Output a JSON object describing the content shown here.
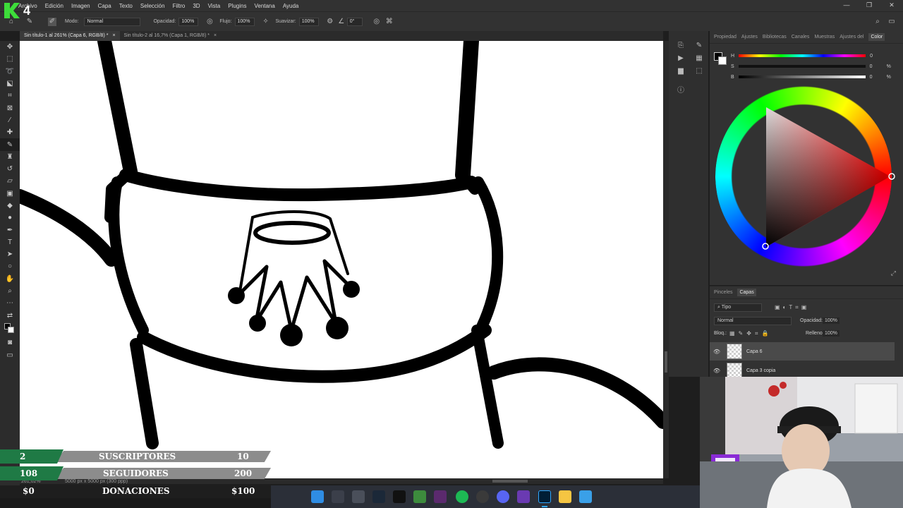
{
  "app": {
    "logo_text": "4"
  },
  "menu": [
    "Archivo",
    "Edición",
    "Imagen",
    "Capa",
    "Texto",
    "Selección",
    "Filtro",
    "3D",
    "Vista",
    "Plugins",
    "Ventana",
    "Ayuda"
  ],
  "window_controls": {
    "minimize": "—",
    "restore": "❐",
    "close": "✕"
  },
  "options": {
    "mode_label": "Modo:",
    "mode_value": "Normal",
    "opacity_label": "Opacidad:",
    "opacity_value": "100%",
    "flow_label": "Flujo:",
    "flow_value": "100%",
    "smoothing_label": "Suavizar:",
    "smoothing_value": "100%",
    "angle_value": "0°"
  },
  "tabs": [
    {
      "label": "Sin título-1 al 261% (Capa 6, RGB/8) *",
      "close": "×"
    },
    {
      "label": "Sin título-2 al 16,7% (Capa 1, RGB/8) *",
      "close": "×"
    }
  ],
  "color_panel": {
    "tabs": [
      "Propiedad",
      "Ajustes",
      "Bibliotecas",
      "Canales",
      "Muestras",
      "Ajustes del",
      "Color"
    ],
    "sliders": [
      {
        "label": "H",
        "value": "0",
        "unit": ""
      },
      {
        "label": "S",
        "value": "0",
        "unit": "%"
      },
      {
        "label": "B",
        "value": "0",
        "unit": "%"
      }
    ]
  },
  "layers_panel": {
    "tabs": [
      "Pinceles",
      "Capas"
    ],
    "filter_label": "Tipo",
    "blend_mode": "Normal",
    "opacity_label": "Opacidad:",
    "opacity_value": "100%",
    "lock_label": "Bloq.:",
    "fill_label": "Relleno:",
    "fill_value": "100%",
    "layers": [
      {
        "name": "Capa 6",
        "selected": true
      },
      {
        "name": "Capa 3 copia",
        "selected": false
      }
    ]
  },
  "status_bar": {
    "zoom": "261,02%",
    "doc_info": "5000 px x 5000 px (300 ppp)"
  },
  "overlay": [
    {
      "left": "2",
      "label": "SUSCRIPTORES",
      "right": "10"
    },
    {
      "left": "108",
      "label": "SEGUIDORES",
      "right": "200"
    },
    {
      "left": "$0",
      "label": "DONACIONES",
      "right": "$100"
    }
  ],
  "colors": {
    "accent": "#1f7a45",
    "ui_dark": "#323232",
    "canvas": "#ffffff"
  }
}
